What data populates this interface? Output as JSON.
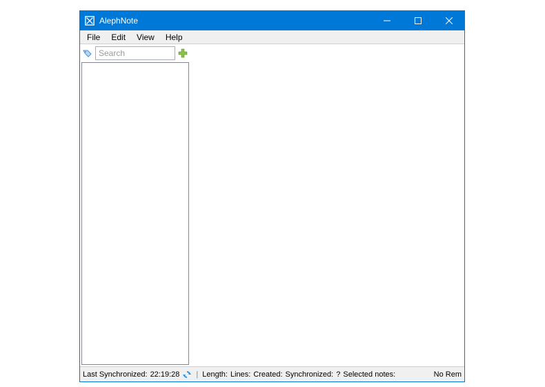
{
  "window": {
    "title": "AlephNote"
  },
  "menubar": {
    "file": "File",
    "edit": "Edit",
    "view": "View",
    "help": "Help"
  },
  "sidebar": {
    "search_placeholder": "Search"
  },
  "statusbar": {
    "last_sync_label": "Last Synchronized:",
    "last_sync_value": "22:19:28",
    "length_label": "Length:",
    "lines_label": "Lines:",
    "created_label": "Created:",
    "synchronized_label": "Synchronized:",
    "synchronized_value": "?",
    "selected_notes_label": "Selected notes:",
    "remote_label": "No Rem"
  }
}
